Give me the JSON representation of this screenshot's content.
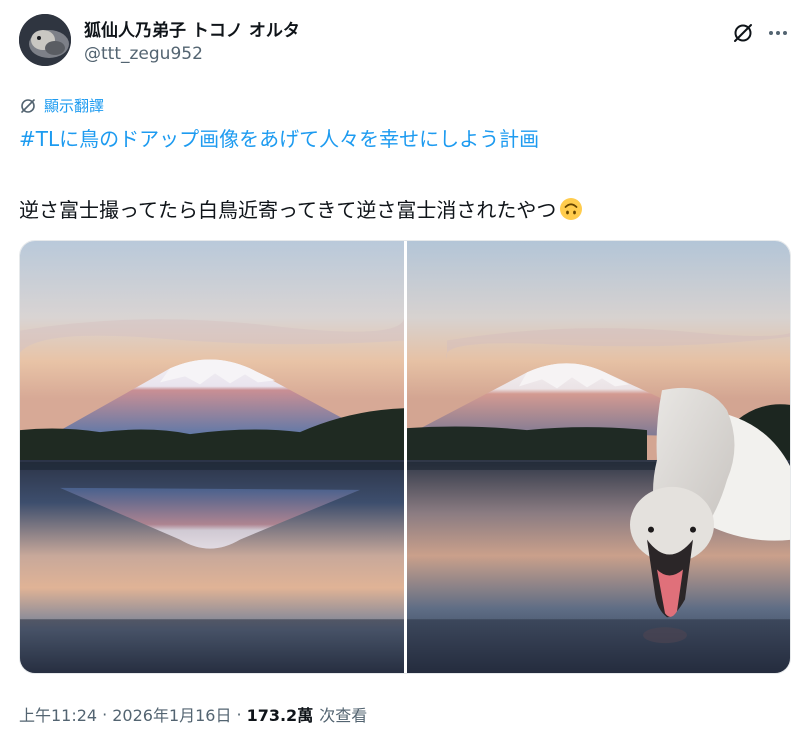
{
  "author": {
    "display_name": "狐仙人乃弟子 トコノ オルタ",
    "handle": "@ttt_zegu952"
  },
  "translate_label": "顯示翻譯",
  "hashtag": "#TLに鳥のドアップ画像をあげて人々を幸せにしよう計画",
  "text": "逆さ富士撮ってたら白鳥近寄ってきて逆さ富士消されたやつ",
  "emoji": "upside-down-face-emoji",
  "media": [
    {
      "subject": "Mount Fuji reflected in a calm lake at dawn"
    },
    {
      "subject": "Mount Fuji at dawn with a swan drinking in the foreground"
    }
  ],
  "timestamp": {
    "time": "上午11:24",
    "date": "2026年1月16日",
    "views_count": "173.2萬",
    "views_label": "次查看"
  },
  "colors": {
    "link": "#1d9bf0",
    "text": "#0f1419",
    "secondary": "#536471"
  },
  "icons": {
    "grok": "grok-icon",
    "more": "more-icon",
    "translate": "globe-translate-icon"
  }
}
